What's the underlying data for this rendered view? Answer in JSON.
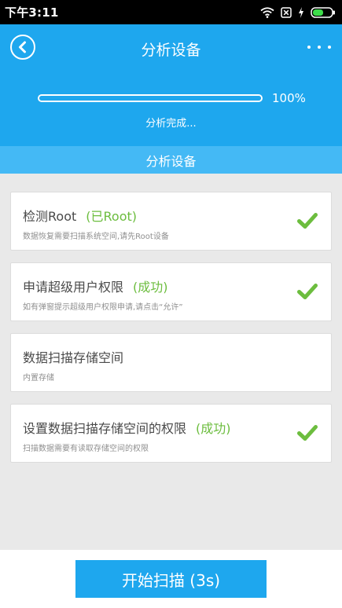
{
  "status_bar": {
    "time": "下午3:11",
    "icons": [
      "wifi-icon",
      "no-sim-icon",
      "charging-icon",
      "battery-icon"
    ]
  },
  "header": {
    "title": "分析设备",
    "back_icon": "chevron-left-icon",
    "more_icon": "more-dots-icon"
  },
  "progress": {
    "value": 100,
    "label": "100%",
    "status": "分析完成..."
  },
  "section": {
    "title": "分析设备"
  },
  "items": [
    {
      "title": "检测Root",
      "status": "(已Root)",
      "desc": "数据恢复需要扫描系统空间,请先Root设备",
      "checked": true
    },
    {
      "title": "申请超级用户权限",
      "status": "(成功)",
      "desc": "如有弹窗提示超级用户权限申请,请点击“允许”",
      "checked": true
    },
    {
      "title": "数据扫描存储空间",
      "status": "",
      "desc": "内置存储",
      "checked": false
    },
    {
      "title": "设置数据扫描存储空间的权限",
      "status": "(成功)",
      "desc": "扫描数据需要有读取存储空间的权限",
      "checked": true
    }
  ],
  "start_button": {
    "label": "开始扫描 (3s)"
  },
  "colors": {
    "primary": "#1ea7ee",
    "section": "#44b9f5",
    "success": "#6cbd3e",
    "background": "#e9e9e9"
  }
}
